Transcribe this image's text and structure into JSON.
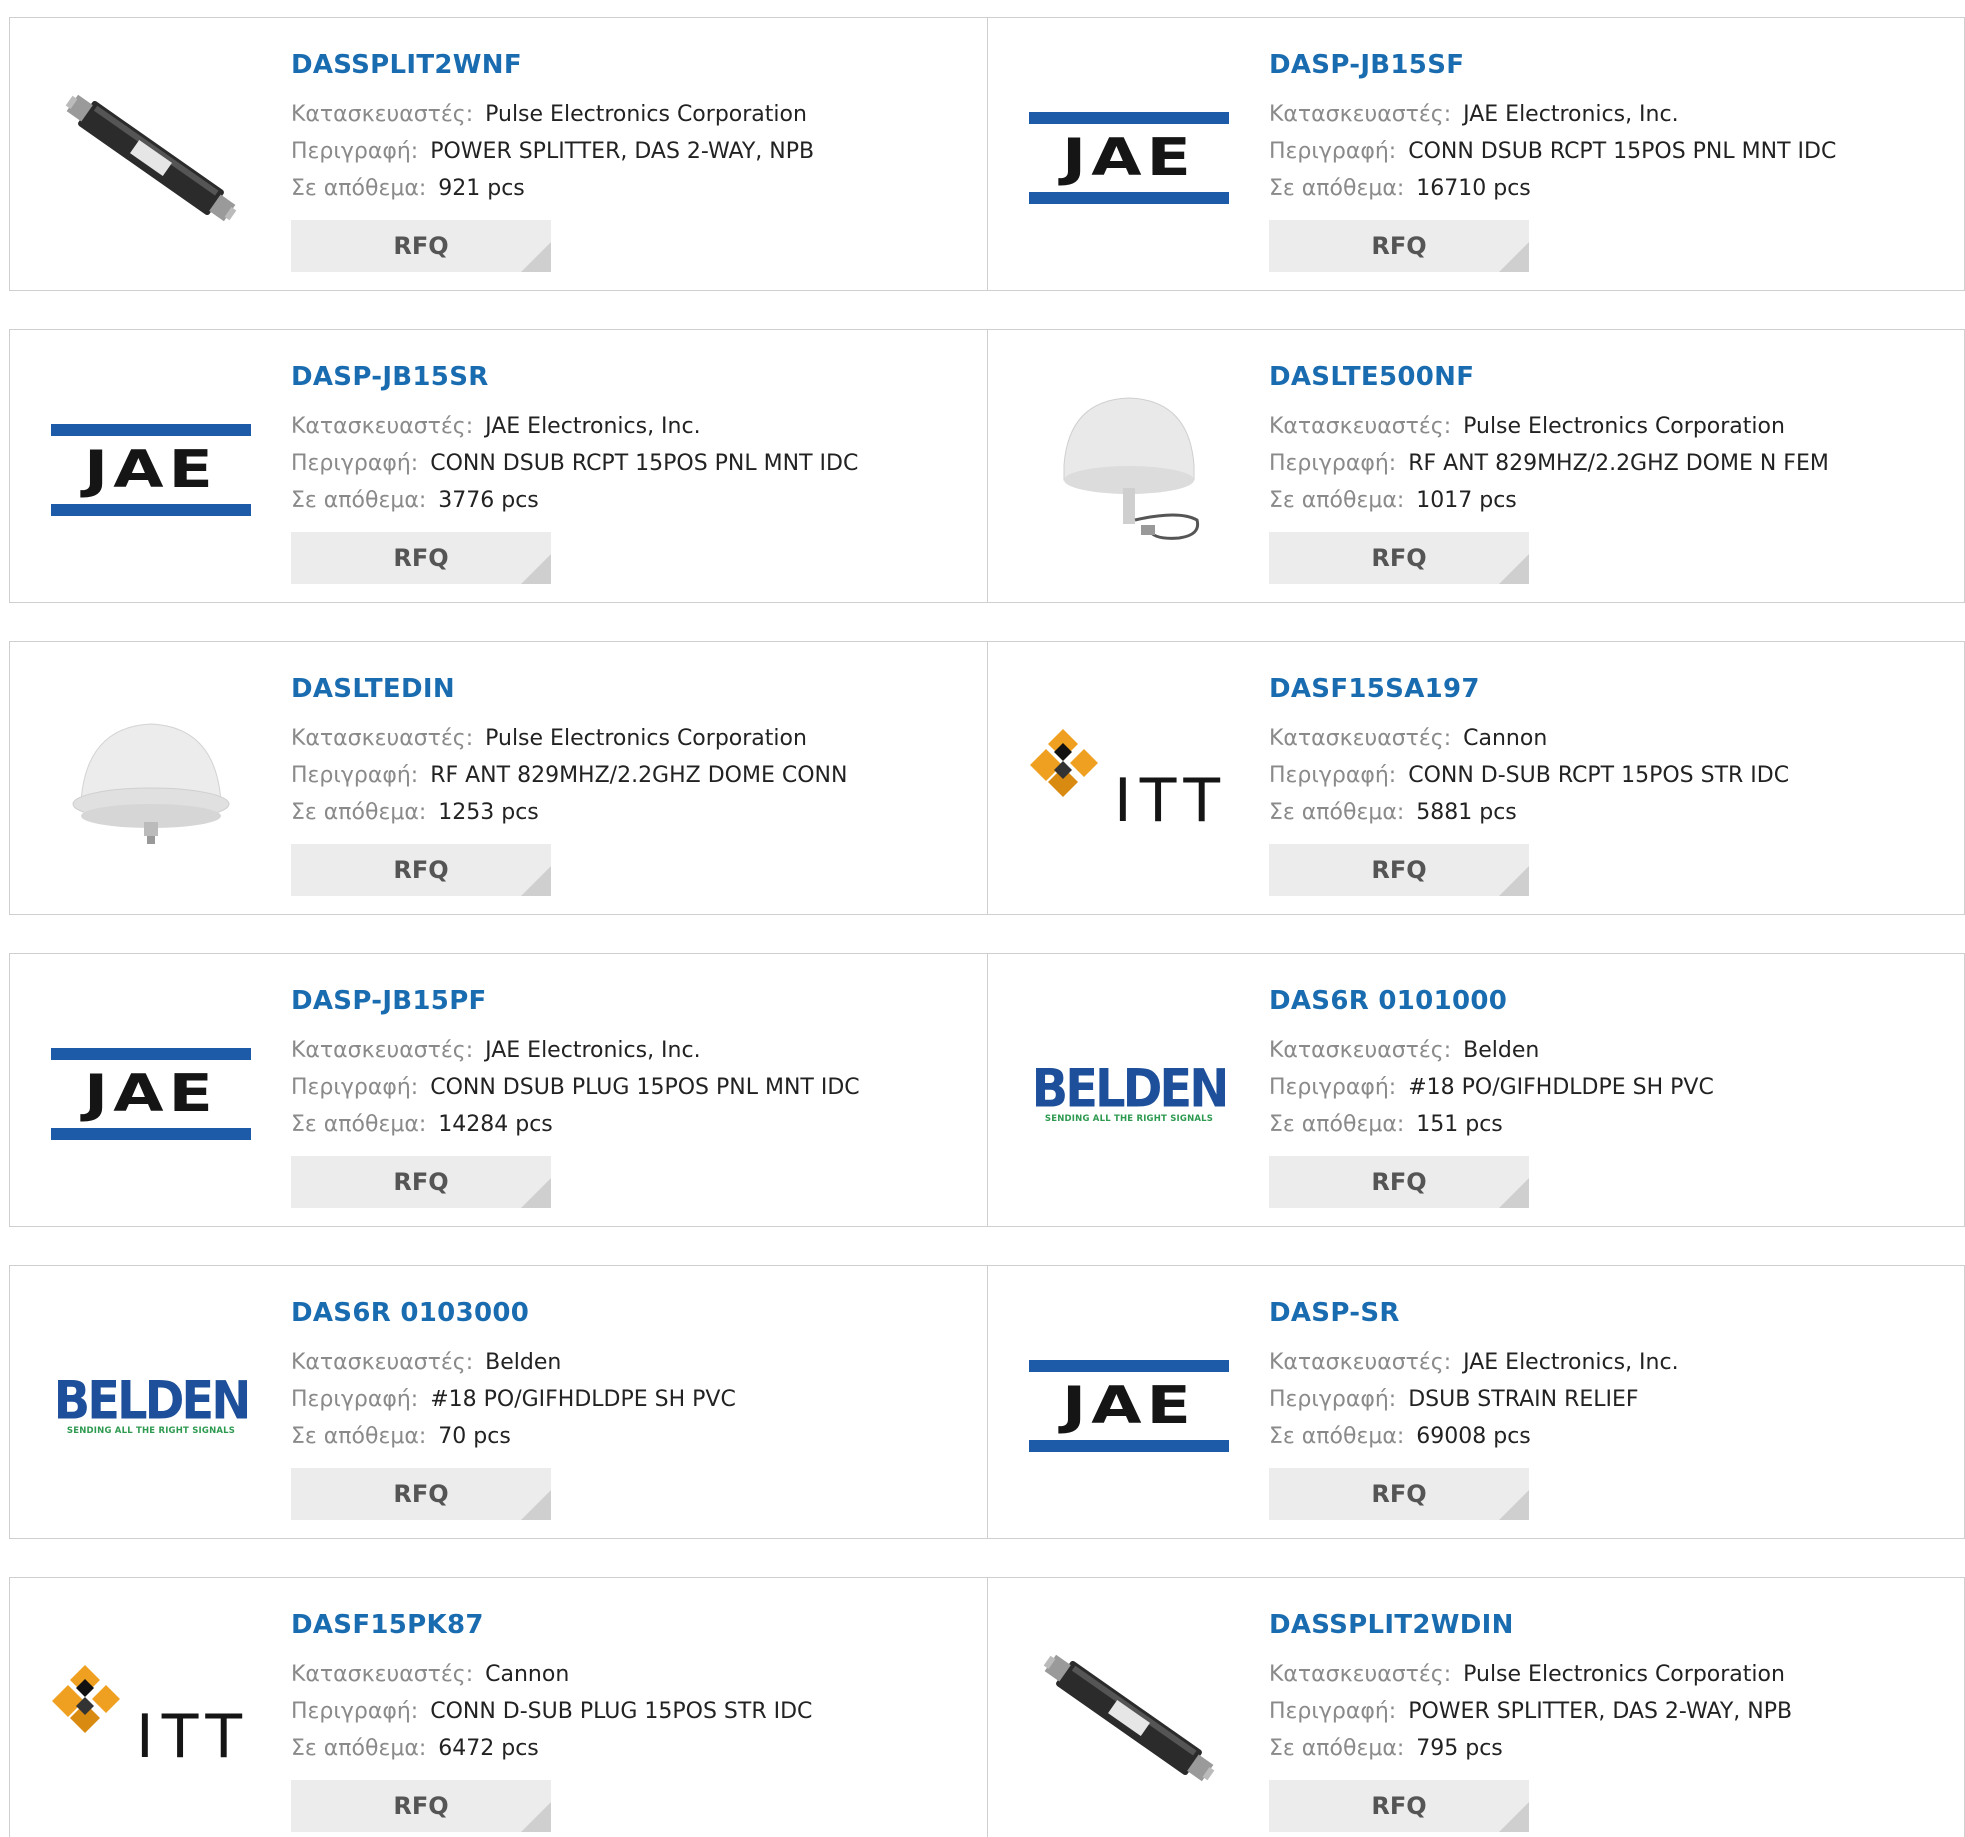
{
  "labels": {
    "manufacturer": "Κατασκευαστές:",
    "description": "Περιγραφή:",
    "stock": "Σε απόθεμα:"
  },
  "rfq_label": "RFQ",
  "brand_colors": {
    "link": "#1a6cb0",
    "jae_blue": "#1d5ba8",
    "belden_blue": "#1d4f9a",
    "belden_green": "#2e9a50",
    "itt_orange": "#f0a020"
  },
  "logo_text": {
    "jae": "JAE",
    "belden": "BELDEN",
    "belden_tagline": "SENDING ALL THE RIGHT SIGNALS",
    "itt": "ITT"
  },
  "products": [
    {
      "pn": "DASSPLIT2WNF",
      "manufacturer": "Pulse Electronics Corporation",
      "description": "POWER SPLITTER, DAS 2-WAY, NPB",
      "stock": "921 pcs",
      "image": "splitter-photo"
    },
    {
      "pn": "DASP-JB15SF",
      "manufacturer": "JAE Electronics, Inc.",
      "description": "CONN DSUB RCPT 15POS PNL MNT IDC",
      "stock": "16710 pcs",
      "image": "jae-logo"
    },
    {
      "pn": "DASP-JB15SR",
      "manufacturer": "JAE Electronics, Inc.",
      "description": "CONN DSUB RCPT 15POS PNL MNT IDC",
      "stock": "3776 pcs",
      "image": "jae-logo"
    },
    {
      "pn": "DASLTE500NF",
      "manufacturer": "Pulse Electronics Corporation",
      "description": "RF ANT 829MHZ/2.2GHZ DOME N FEM",
      "stock": "1017 pcs",
      "image": "dome-antenna-cable-photo"
    },
    {
      "pn": "DASLTEDIN",
      "manufacturer": "Pulse Electronics Corporation",
      "description": "RF ANT 829MHZ/2.2GHZ DOME CONN",
      "stock": "1253 pcs",
      "image": "dome-antenna-photo"
    },
    {
      "pn": "DASF15SA197",
      "manufacturer": "Cannon",
      "description": "CONN D-SUB RCPT 15POS STR IDC",
      "stock": "5881 pcs",
      "image": "itt-logo"
    },
    {
      "pn": "DASP-JB15PF",
      "manufacturer": "JAE Electronics, Inc.",
      "description": "CONN DSUB PLUG 15POS PNL MNT IDC",
      "stock": "14284 pcs",
      "image": "jae-logo"
    },
    {
      "pn": "DAS6R 0101000",
      "manufacturer": "Belden",
      "description": "#18 PO/GIFHDLDPE SH PVC",
      "stock": "151 pcs",
      "image": "belden-logo"
    },
    {
      "pn": "DAS6R 0103000",
      "manufacturer": "Belden",
      "description": "#18 PO/GIFHDLDPE SH PVC",
      "stock": "70 pcs",
      "image": "belden-logo"
    },
    {
      "pn": "DASP-SR",
      "manufacturer": "JAE Electronics, Inc.",
      "description": "DSUB STRAIN RELIEF",
      "stock": "69008 pcs",
      "image": "jae-logo"
    },
    {
      "pn": "DASF15PK87",
      "manufacturer": "Cannon",
      "description": "CONN D-SUB PLUG 15POS STR IDC",
      "stock": "6472 pcs",
      "image": "itt-logo"
    },
    {
      "pn": "DASSPLIT2WDIN",
      "manufacturer": "Pulse Electronics Corporation",
      "description": "POWER SPLITTER, DAS 2-WAY, NPB",
      "stock": "795 pcs",
      "image": "splitter-photo"
    }
  ]
}
